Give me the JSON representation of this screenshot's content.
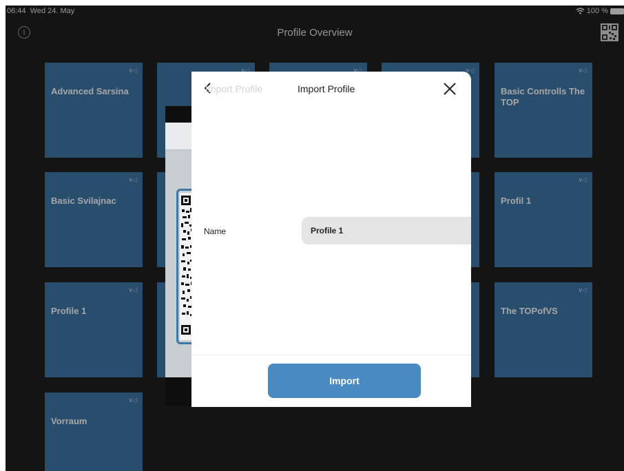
{
  "status": {
    "time": "06:44",
    "date": "Wed 24. May",
    "battery": "100 %",
    "wifi_icon": "wifi-icon"
  },
  "header": {
    "title": "Profile Overview",
    "info_icon": "info-icon",
    "qr_icon": "qr-code-icon"
  },
  "profiles": [
    {
      "label": "Advanced Sarsina"
    },
    {
      "label": ""
    },
    {
      "label": ""
    },
    {
      "label": ""
    },
    {
      "label": "Basic Controlls The TOP"
    },
    {
      "label": "Basic Svilajnac"
    },
    {
      "label": "Profil 1"
    },
    {
      "label": "Profile 1"
    },
    {
      "label": "The TOPofVS"
    },
    {
      "label": "Vorraum"
    }
  ],
  "modal": {
    "ghost_title": "Import Profile",
    "title": "Import Profile",
    "name_label": "Name",
    "name_value": "Profile 1",
    "import_label": "Import"
  },
  "colors": {
    "tile": "#3f77a8",
    "button": "#4a8ac2",
    "background": "#1f1f1f"
  }
}
